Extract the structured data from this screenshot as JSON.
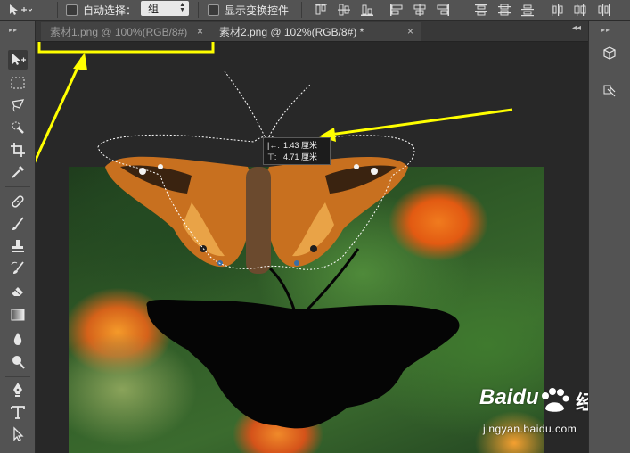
{
  "options": {
    "auto_select_label": "自动选择：",
    "group_value": "组",
    "show_transform_label": "显示变换控件"
  },
  "tabs": [
    {
      "label": "素材1.png @ 100%(RGB/8#)",
      "close": "×"
    },
    {
      "label": "素材2.png @ 102%(RGB/8#) *",
      "close": "×"
    }
  ],
  "tooltip": {
    "dx_key": "|←:",
    "dx_value": "1.43 厘米",
    "dy_key": "⊤:",
    "dy_value": "4.71 厘米"
  },
  "watermark": {
    "brand": "Baidu",
    "brand_suffix": "经验",
    "url": "jingyan.baidu.com"
  },
  "colors": {
    "highlight": "#ffff00",
    "panel": "#535353",
    "canvas": "#282828"
  },
  "icons": {
    "toolbar": [
      "move-tool-icon",
      "marquee-tool-icon",
      "lasso-tool-icon",
      "quick-select-tool-icon",
      "crop-tool-icon",
      "eyedropper-tool-icon",
      "healing-brush-tool-icon",
      "brush-tool-icon",
      "clone-stamp-tool-icon",
      "history-brush-tool-icon",
      "eraser-tool-icon",
      "gradient-tool-icon",
      "blur-tool-icon",
      "dodge-tool-icon",
      "pen-tool-icon",
      "type-tool-icon",
      "path-select-tool-icon"
    ],
    "right_panel": [
      "3d-cube-icon",
      "layers-panel-icon"
    ]
  }
}
